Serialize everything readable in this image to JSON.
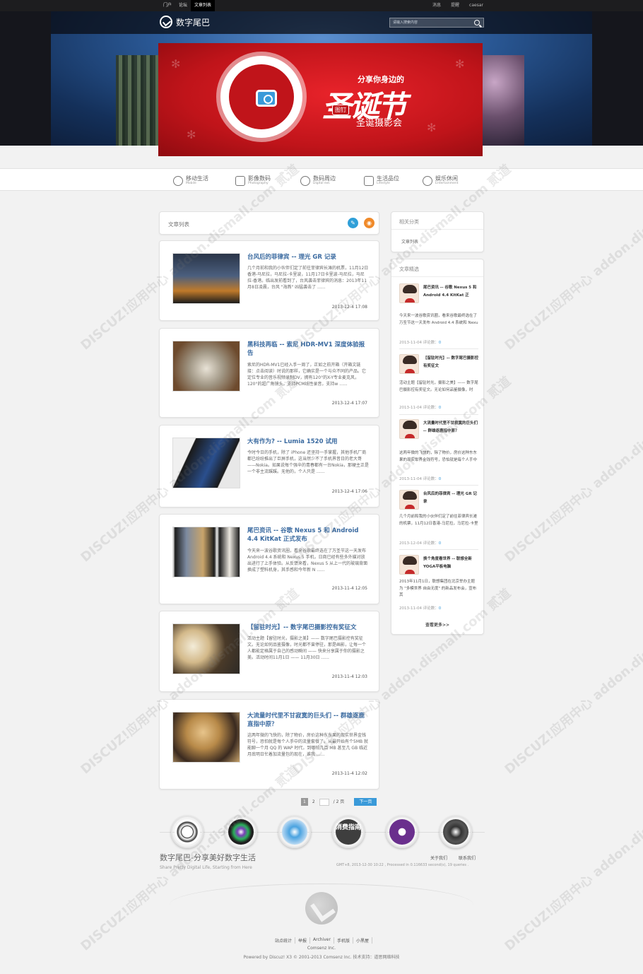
{
  "topbar": {
    "nav": [
      "门户",
      "论坛",
      "文章列表"
    ],
    "active_index": 2,
    "links": [
      "消息",
      "提醒",
      "caesar"
    ]
  },
  "site": {
    "name": "数字尾巴",
    "search_placeholder": "请输入搜索内容"
  },
  "promo": {
    "small": "分享你身边的",
    "big": "圣诞节",
    "tag": "图钉",
    "sub": "圣诞摄影会"
  },
  "categories": [
    {
      "zh": "移动生活",
      "en": "Mobile",
      "icon": "speech-bubble-icon"
    },
    {
      "zh": "影像数码",
      "en": "Photography",
      "icon": "camera-icon"
    },
    {
      "zh": "数码周边",
      "en": "Digital ext.",
      "icon": "headphones-icon"
    },
    {
      "zh": "生活品位",
      "en": "Lifestyle",
      "icon": "newspaper-icon"
    },
    {
      "zh": "娱乐休闲",
      "en": "Entertainment",
      "icon": "music-note-icon"
    }
  ],
  "list": {
    "title": "文章列表",
    "articles": [
      {
        "title": "台风后的菲律宾 -- 理光 GR 记录",
        "summary": "几个月前和我的小伙伴们定了前往菲律宾长滩的机票，11月12日香港-马尼拉，马尼拉-卡里波，11月17日卡里波-马尼拉，马尼拉-香港。临出发前看到了，台风袭击菲律宾的消息：2013年11月8日凌晨，台风 \"海燕\" 凶猛袭击了 ......",
        "date": "2013-12-4 17:08"
      },
      {
        "title": "黑科技再临 -- 索尼 HDR-MV1 深度体验报告",
        "summary": "索尼的HDR-MV1已经入手一周了，正如之前开箱（开箱文链接：点击阅读）时说的那样，它确实是一个与众不同的产品。它定位专业的音乐视频录制DV，拥有120°的X-Y专业麦克风，120°的超广角镜头，支持PCM线性录音，支持w ......",
        "date": "2013-12-4 17:07"
      },
      {
        "title": "大有作为? -- Lumia 1520 试用",
        "summary": "今时今日的手机，除了 iPhone 还坚持一手掌握，其他手机厂商都已纷纷推出了巨屏手机，这当然少不了手机界昔日的老大哥——Nokia。如果说每个强辛的青春都有一台Nokia，那硬主正是一个非主流蹊蹊。无他的，个人只是 ......",
        "date": "2013-12-4 17:06"
      },
      {
        "title": "尾巴资讯 -- 谷歌 Nexus 5 和 Android 4.4 KitKat 正式发布",
        "summary": "今天来一波谷歌资讯圈，看来谷歌最终选在了万圣节这一天发布 Android 4.4 系统和 Nexus 5 手机，日商已经有些多外媒对放出进行了上手体验。从反馈来看，Nexus 5 从上一代的玻璃背面换成了塑料机身，其手感和今年新 N ......",
        "date": "2013-11-4 12:05"
      },
      {
        "title": "【留驻时光】-- 数字尾巴摄影控有奖征文",
        "summary": "活动主题【留驻时光，摄影之美】—— 数字尾巴摄影控有奖征文。无论如何品鉴摄像，时光都不曾停驻，那是画影，让每一个人都能定格属于自己的感动瞬间 —— 快来分享属于你的摄影之美。活动时间11月1日 —— 11月30日 ......",
        "date": "2013-11-4 12:03"
      },
      {
        "title": "大流量时代里不甘寂寞的巨头们 -- 群雄逐鹿直指中原？",
        "summary": "这两年微的飞快的，除了物价，房价这种东东果的现实世界金钱符号，恐怕就是每个人手中的流量套餐了。从最开始有个5MB 就能聊一个月 QQ 的 WAP 时代，到哪怕几百 MB 甚至几 GB 临近月底明日忙着加流量包的现在，谁我 ......",
        "date": "2013-11-4 12:02"
      }
    ]
  },
  "sidebar": {
    "related_title": "相关分类",
    "related_link": "文章列表",
    "featured_title": "文章精选",
    "featured": [
      {
        "title": "尾巴资讯 -- 谷歌 Nexus 5 和 Android 4.4 KitKat 正",
        "summary": "今天来一波谷歌资讯圈，看来谷歌最终选在了万圣节这一天发布 Android 4.4 系统和 Nexu",
        "date": "2013-11-04",
        "comments_label": "评论数：",
        "comments": "0"
      },
      {
        "title": "【留驻时光】-- 数字尾巴摄影控有奖征文",
        "summary": "活动主题【留驻时光，摄影之美】—— 数字尾巴摄影控有奖征文。无论如何品鉴摄像，时",
        "date": "2013-11-04",
        "comments_label": "评论数：",
        "comments": "0"
      },
      {
        "title": "大流量时代里不甘寂寞的巨头们 -- 群雄逐鹿指中原？",
        "summary": "这两年微的飞快的，除了物价，房价这种东东果的现实世界金钱符号，恐怕就是每个人手中",
        "date": "2013-11-04",
        "comments_label": "评论数：",
        "comments": "0"
      },
      {
        "title": "台风后的菲律宾 -- 理光 GR 记录",
        "summary": "几个月前和我的小伙伴们定了前往菲律宾长滩的机票，11月12日香港-马尼拉，马尼拉-卡里",
        "date": "2013-12-04",
        "comments_label": "评论数：",
        "comments": "0"
      },
      {
        "title": "换个角度看世界 -- 联想全新YOGA平板电脑",
        "summary": "2013年11月1日，联想集团在北京举办主题为 \"多模世界 自由无度\" 的新品发布会，宣布其",
        "date": "2013-11-04",
        "comments_label": "评论数：",
        "comments": "0"
      }
    ],
    "more": "查看更多>>"
  },
  "pager": {
    "current": "1",
    "page2": "2",
    "total": "/ 2 页",
    "next": "下一页"
  },
  "footer": {
    "title": "数字尾巴-分享美好数字生活",
    "subtitle": "Share Pretty Digital Life, Starting from Here",
    "links": [
      "关于我们",
      "联系我们"
    ],
    "stat": "GMT+8, 2013-12-30 10:22 , Processed in 0.116633 second(s), 19 queries .",
    "bottom_links": [
      "站点统计",
      "举报",
      "Archiver",
      "手机版",
      "小黑屋"
    ],
    "comsenz": "Comsenz Inc.",
    "powered": "Powered by Discuz! X3 © 2001-2013 Comsenz Inc. 技术支持：道思网络科技"
  },
  "app_icons": [
    "tail-logo-icon",
    "camera-lens-icon",
    "robot-app-icon",
    "consumer-guide-icon",
    "windows-logo-icon",
    "chat-bird-icon"
  ],
  "app_icon_label": "消费指南",
  "watermark": "DISCUZ!应用中心 addon.dismall.com 贰道"
}
